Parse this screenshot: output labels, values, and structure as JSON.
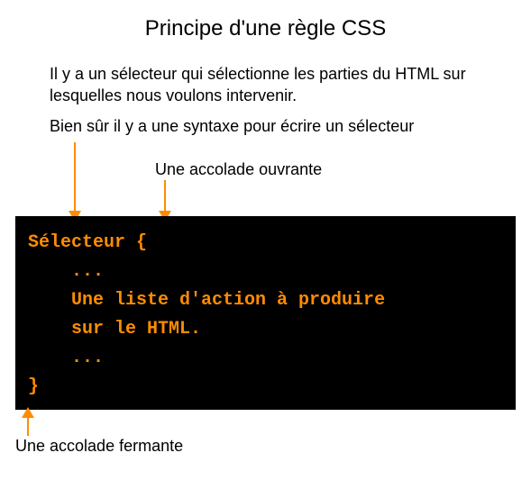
{
  "title": "Principe d'une règle CSS",
  "paragraphs": {
    "p1": "Il y a un sélecteur qui sélectionne les parties du HTML sur lesquelles nous voulons intervenir.",
    "p2": "Bien sûr il y a une syntaxe pour écrire un sélecteur"
  },
  "annotations": {
    "open_brace": "Une accolade ouvrante",
    "close_brace": "Une accolade fermante"
  },
  "code": {
    "line1": "Sélecteur {",
    "line2": "    ...",
    "line3": "    Une liste d'action à produire",
    "line4": "    sur le HTML.",
    "line5": "    ...",
    "line6": "}"
  },
  "colors": {
    "code_bg": "#000000",
    "code_fg": "#ff8c00",
    "arrow": "#ff8c00"
  }
}
